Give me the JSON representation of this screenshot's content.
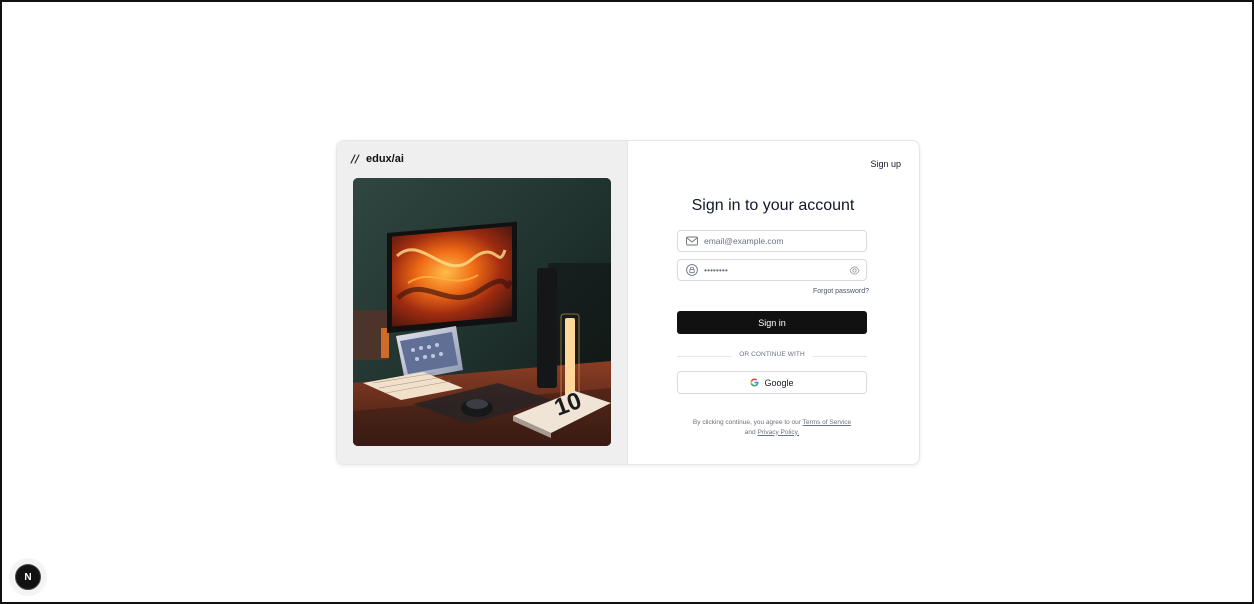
{
  "brand": {
    "name": "edux/ai"
  },
  "header": {
    "signup_link": "Sign up"
  },
  "form": {
    "title": "Sign in to your account",
    "email": {
      "value": "",
      "placeholder": "email@example.com",
      "icon": "mail-icon"
    },
    "password": {
      "value": "••••••••",
      "placeholder": "••••••••",
      "icon": "lock-icon",
      "toggle_icon": "eye-icon"
    },
    "forgot_password": "Forgot password?",
    "sign_in_button": "Sign in",
    "divider_text": "OR CONTINUE WITH",
    "google_button": "Google",
    "legal": {
      "prefix": "By clicking continue, you agree to our",
      "terms": "Terms of Service",
      "middle": "and",
      "privacy": "Privacy Policy."
    }
  },
  "badge": {
    "label": "N"
  },
  "colors": {
    "primary_button": "#111112",
    "left_panel": "#efefef",
    "border": "#d9d9de"
  }
}
